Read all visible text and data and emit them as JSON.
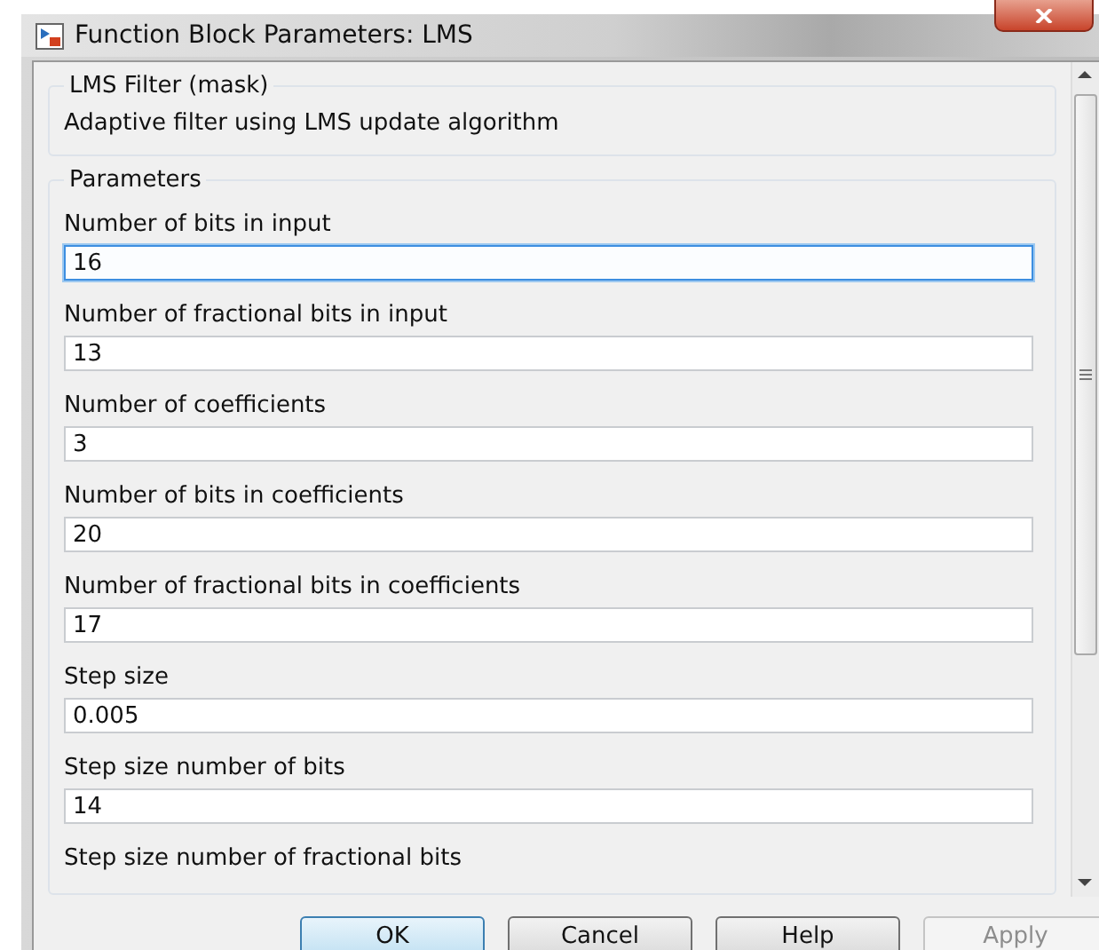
{
  "window": {
    "title": "Function Block Parameters: LMS"
  },
  "mask": {
    "title": "LMS Filter (mask)",
    "description": "Adaptive filter using LMS update algorithm"
  },
  "parameters": {
    "title": "Parameters",
    "fields": [
      {
        "label": "Number of bits in input",
        "value": "16",
        "focused": true
      },
      {
        "label": "Number of fractional bits in input",
        "value": "13",
        "focused": false
      },
      {
        "label": "Number of coefficients",
        "value": "3",
        "focused": false
      },
      {
        "label": "Number of bits in coefficients",
        "value": "20",
        "focused": false
      },
      {
        "label": "Number of fractional bits in coefficients",
        "value": "17",
        "focused": false
      },
      {
        "label": "Step size",
        "value": "0.005",
        "focused": false
      },
      {
        "label": "Step size number of bits",
        "value": "14",
        "focused": false
      },
      {
        "label": "Step size number of fractional bits"
      }
    ]
  },
  "buttons": [
    {
      "label": "OK",
      "default": true,
      "disabled": false
    },
    {
      "label": "Cancel",
      "default": false,
      "disabled": false
    },
    {
      "label": "Help",
      "default": false,
      "disabled": false
    },
    {
      "label": "Apply",
      "default": false,
      "disabled": true
    }
  ]
}
